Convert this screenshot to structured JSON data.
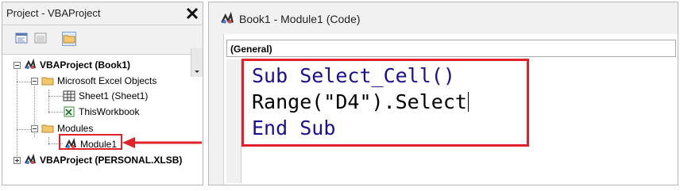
{
  "project_pane": {
    "title": "Project - VBAProject",
    "toolbar": [
      "view-code",
      "view-object",
      "toggle-folders"
    ],
    "tree": [
      {
        "label": "VBAProject (Book1)",
        "bold": true
      },
      {
        "label": "Microsoft Excel Objects",
        "bold": false
      },
      {
        "label": "Sheet1 (Sheet1)",
        "bold": false
      },
      {
        "label": "ThisWorkbook",
        "bold": false
      },
      {
        "label": "Modules",
        "bold": false
      },
      {
        "label": "Module1",
        "bold": false
      },
      {
        "label": "VBAProject (PERSONAL.XLSB)",
        "bold": true
      }
    ]
  },
  "code_window": {
    "title": "Book1 - Module1 (Code)",
    "object_dropdown": "(General)",
    "lines": {
      "l1_kw": "Sub",
      "l1_rest": " Select_Cell()",
      "l2": "Range(\"D4\").Select",
      "l3_kw1": "End",
      "l3_kw2": "Sub"
    }
  },
  "colors": {
    "highlight": "#e1222a",
    "keyword": "#1a0e94"
  }
}
